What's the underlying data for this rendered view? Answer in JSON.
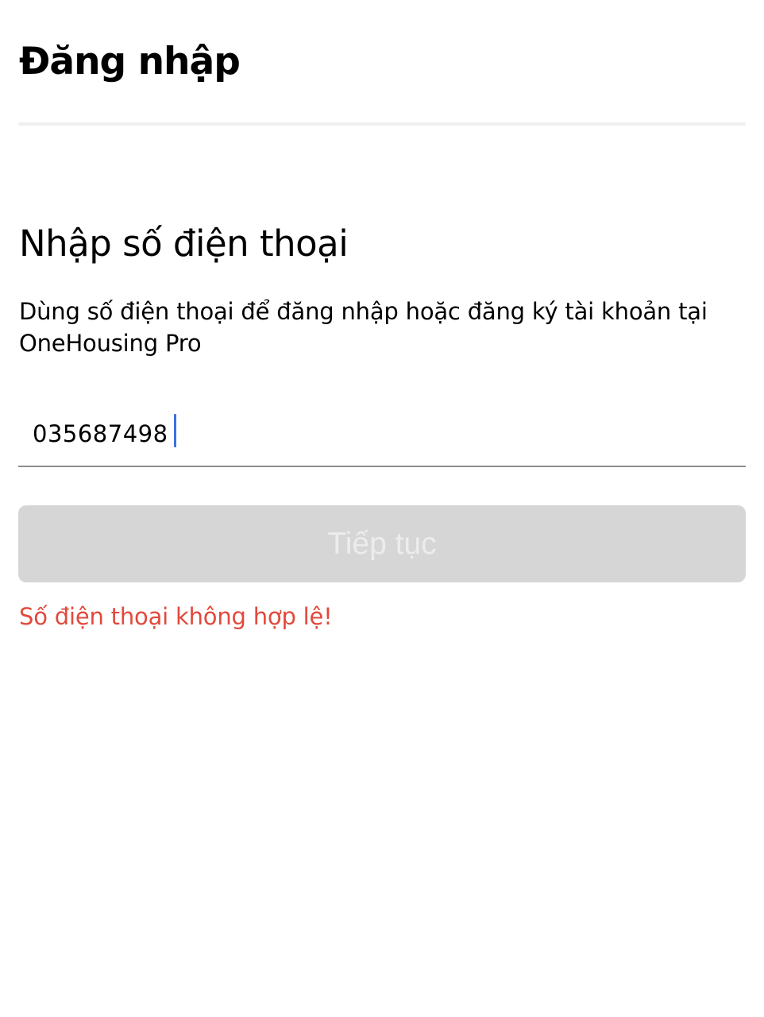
{
  "header": {
    "title": "Đăng nhập"
  },
  "login": {
    "section_title": "Nhập số điện thoại",
    "description": "Dùng số điện thoại để đăng nhập hoặc đăng ký tài khoản tại OneHousing Pro",
    "phone_value": "035687498",
    "continue_label": "Tiếp tục",
    "continue_enabled": false,
    "error_message": "Số điện thoại không hợp lệ!"
  },
  "colors": {
    "caret": "#3f6fe6",
    "button_disabled_bg": "#d6d6d6",
    "button_disabled_text": "#ececec",
    "error": "#e2493c",
    "underline": "#8e8e8e"
  }
}
